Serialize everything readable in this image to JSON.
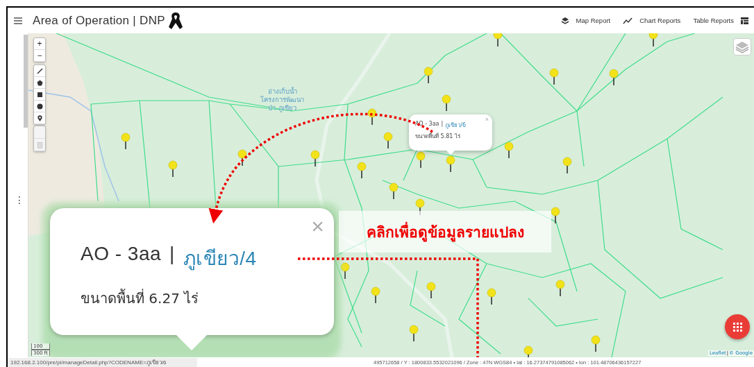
{
  "header": {
    "title": "Area of Operation | DNP",
    "nav": [
      {
        "label": "Map Report",
        "kind": "layers"
      },
      {
        "label": "Chart Reports",
        "kind": "chart"
      },
      {
        "label": "Table Reports",
        "kind": "table"
      }
    ]
  },
  "sidebar": {
    "handle": "⋮"
  },
  "map": {
    "zoom": [
      "+",
      "−"
    ],
    "place_label": [
      "อ่างเก็บน้ำ",
      "โครงการพัฒนา",
      "ป่า ภูเขียว"
    ],
    "popup": {
      "code": "AO - 3aa",
      "separator": "|",
      "link": "ภูเขียว/6",
      "area": "ขนาดพื้นที่ 5.81 ไร่",
      "close": "×"
    },
    "callout": {
      "code": "AO - 3aa",
      "separator": "|",
      "link": "ภูเขียว/4",
      "area": "ขนาดพื้นที่ 6.27 ไร่",
      "close": "×"
    },
    "annotation": "คลิกเพื่อดูข้อมูลรายแปลง",
    "scale": [
      "100",
      "300 ft"
    ],
    "attribution": [
      "Leaflet",
      "|",
      "© Google"
    ]
  },
  "status": {
    "url": "192.168.2.100/pre/pi/manageDetail.php?CODENAME=ภูเขียว/6",
    "coords": "495712658 / Y : 1800833.5532021096 / Zone : 47N WGS84 • lat : 16.27374791085062 • lon : 101.48706436157227"
  }
}
